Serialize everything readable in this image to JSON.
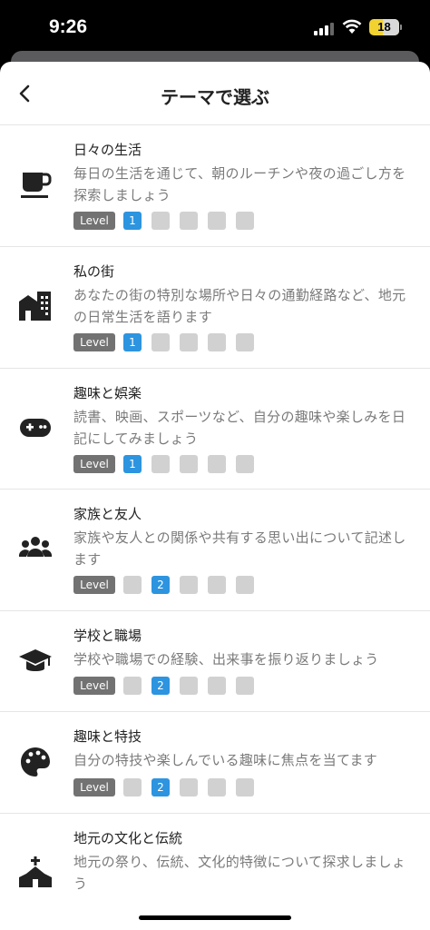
{
  "status": {
    "time": "9:26",
    "battery": "18"
  },
  "nav": {
    "title": "テーマで選ぶ"
  },
  "level_label": "Level",
  "themes": [
    {
      "title": "日々の生活",
      "desc": "毎日の生活を通じて、朝のルーチンや夜の過ごし方を探索しましょう",
      "level": 1,
      "icon": "coffee-cup-icon"
    },
    {
      "title": "私の街",
      "desc": "あなたの街の特別な場所や日々の通勤経路など、地元の日常生活を語ります",
      "level": 1,
      "icon": "city-buildings-icon"
    },
    {
      "title": "趣味と娯楽",
      "desc": "読書、映画、スポーツなど、自分の趣味や楽しみを日記にしてみましょう",
      "level": 1,
      "icon": "gamepad-icon"
    },
    {
      "title": "家族と友人",
      "desc": "家族や友人との関係や共有する思い出について記述します",
      "level": 2,
      "icon": "people-group-icon"
    },
    {
      "title": "学校と職場",
      "desc": "学校や職場での経験、出来事を振り返りましょう",
      "level": 2,
      "icon": "graduation-cap-icon"
    },
    {
      "title": "趣味と特技",
      "desc": "自分の特技や楽しんでいる趣味に焦点を当てます",
      "level": 2,
      "icon": "palette-icon"
    },
    {
      "title": "地元の文化と伝統",
      "desc": "地元の祭り、伝統、文化的特徴について探求しましょう",
      "level": null,
      "icon": "church-icon"
    }
  ],
  "colors": {
    "accent": "#2d94df",
    "inactive_box": "#d1d1d1",
    "level_tag": "#727272"
  }
}
